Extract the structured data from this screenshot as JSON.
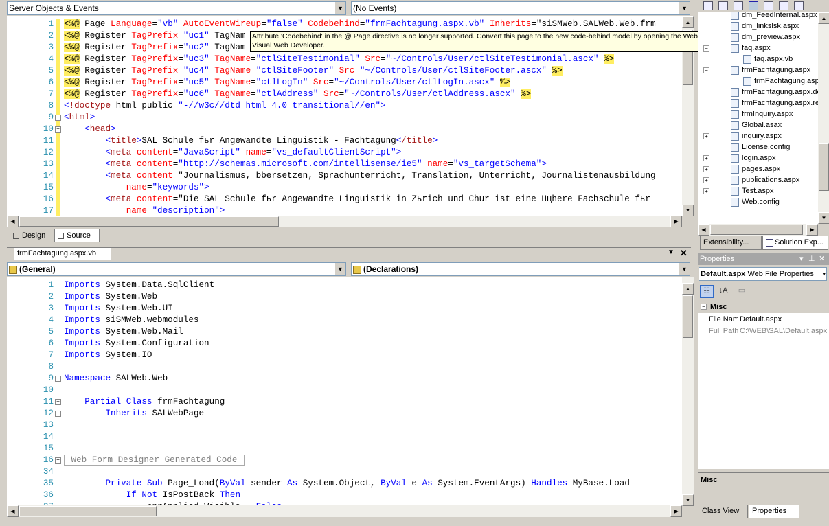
{
  "top_editor": {
    "left_combo": "Server Objects & Events",
    "right_combo": "(No Events)",
    "tooltip": "Attribute 'Codebehind' in the @ Page directive is no longer supported. Convert this page to the new code-behind model by opening the Web site (project) containing the page in Visual Web Developer.",
    "lines": [
      {
        "n": "1",
        "t": "<%@ Page Language=\"vb\" AutoEventWireup=\"false\" Codebehind=\"frmFachtagung.aspx.vb\" Inherits=\"siSMWeb.SALWeb.Web.frm"
      },
      {
        "n": "2",
        "t": "<%@ Register TagPrefix=\"uc1\" TagNam"
      },
      {
        "n": "3",
        "t": "<%@ Register TagPrefix=\"uc2\" TagNam"
      },
      {
        "n": "4",
        "t": "<%@ Register TagPrefix=\"uc3\" TagName=\"ctlSiteTestimonial\" Src=\"~/Controls/User/ctlSiteTestimonial.ascx\" %>"
      },
      {
        "n": "5",
        "t": "<%@ Register TagPrefix=\"uc4\" TagName=\"ctlSiteFooter\" Src=\"~/Controls/User/ctlSiteFooter.ascx\" %>"
      },
      {
        "n": "6",
        "t": "<%@ Register TagPrefix=\"uc5\" TagName=\"ctlLogIn\" Src=\"~/Controls/User/ctlLogIn.ascx\" %>"
      },
      {
        "n": "7",
        "t": "<%@ Register TagPrefix=\"uc6\" TagName=\"ctlAddress\" Src=\"~/Controls/User/ctlAddress.ascx\" %>"
      },
      {
        "n": "8",
        "t": "<!doctype html public \"-//w3c//dtd html 4.0 transitional//en\">"
      },
      {
        "n": "9",
        "t": "<html>"
      },
      {
        "n": "10",
        "t": "    <head>"
      },
      {
        "n": "11",
        "t": "        <title>SAL Schule fьr Angewandte Linguistik - Fachtagung</title>"
      },
      {
        "n": "12",
        "t": "        <meta content=\"JavaScript\" name=\"vs_defaultClientScript\">"
      },
      {
        "n": "13",
        "t": "        <meta content=\"http://schemas.microsoft.com/intellisense/ie5\" name=\"vs_targetSchema\">"
      },
      {
        "n": "14",
        "t": "        <meta content=\"Journalismus, bbersetzen, Sprachunterricht, Translation, Unterricht, Journalistenausbildung"
      },
      {
        "n": "15",
        "t": "            name=\"keywords\">"
      },
      {
        "n": "16",
        "t": "        <meta content=\"Die SAL Schule fьr Angewandte Linguistik in Zьrich und Chur ist eine Hцhere Fachschule fьr"
      },
      {
        "n": "17",
        "t": "            name=\"description\">"
      }
    ],
    "design_tab": "Design",
    "source_tab": "Source"
  },
  "bottom_editor": {
    "doc_tab": "frmFachtagung.aspx.vb",
    "left_combo": "(General)",
    "right_combo": "(Declarations)",
    "lines": [
      {
        "n": "1",
        "t": "Imports System.Data.SqlClient"
      },
      {
        "n": "2",
        "t": "Imports System.Web"
      },
      {
        "n": "3",
        "t": "Imports System.Web.UI"
      },
      {
        "n": "4",
        "t": "Imports siSMWeb.webmodules"
      },
      {
        "n": "5",
        "t": "Imports System.Web.Mail"
      },
      {
        "n": "6",
        "t": "Imports System.Configuration"
      },
      {
        "n": "7",
        "t": "Imports System.IO"
      },
      {
        "n": "8",
        "t": ""
      },
      {
        "n": "9",
        "t": "Namespace SALWeb.Web"
      },
      {
        "n": "10",
        "t": ""
      },
      {
        "n": "11",
        "t": "    Partial Class frmFachtagung"
      },
      {
        "n": "12",
        "t": "        Inherits SALWebPage"
      },
      {
        "n": "13",
        "t": ""
      },
      {
        "n": "14",
        "t": ""
      },
      {
        "n": "15",
        "t": ""
      },
      {
        "n": "16",
        "t": " Web Form Designer Generated Code "
      },
      {
        "n": "34",
        "t": ""
      },
      {
        "n": "35",
        "t": "        Private Sub Page_Load(ByVal sender As System.Object, ByVal e As System.EventArgs) Handles MyBase.Load"
      },
      {
        "n": "36",
        "t": "            If Not IsPostBack Then"
      },
      {
        "n": "37",
        "t": "                pnrApplied.Visible = False"
      }
    ]
  },
  "solution_explorer": {
    "items": [
      "dm_FeedInternal.aspx",
      "dm_linkslsk.aspx",
      "dm_preview.aspx",
      "faq.aspx",
      "faq.aspx.vb",
      "frmFachtagung.aspx",
      "frmFachtagung.aspx.vb",
      "frmFachtagung.aspx.designer.vb",
      "frmFachtagung.aspx.resx",
      "frmInquiry.aspx",
      "Global.asax",
      "inquiry.aspx",
      "License.config",
      "login.aspx",
      "pages.aspx",
      "publications.aspx",
      "Test.aspx",
      "Web.config"
    ],
    "tabs": [
      "Extensibility...",
      "Solution Exp..."
    ]
  },
  "properties": {
    "title": "Properties",
    "object": "Default.aspx",
    "object_type": "Web File Properties",
    "category": "Misc",
    "rows": [
      {
        "k": "File Nam",
        "v": "Default.aspx"
      },
      {
        "k": "Full Path",
        "v": "C:\\WEB\\SAL\\Default.aspx"
      }
    ],
    "desc_title": "Misc",
    "tabs": [
      "Class View",
      "Properties"
    ]
  }
}
